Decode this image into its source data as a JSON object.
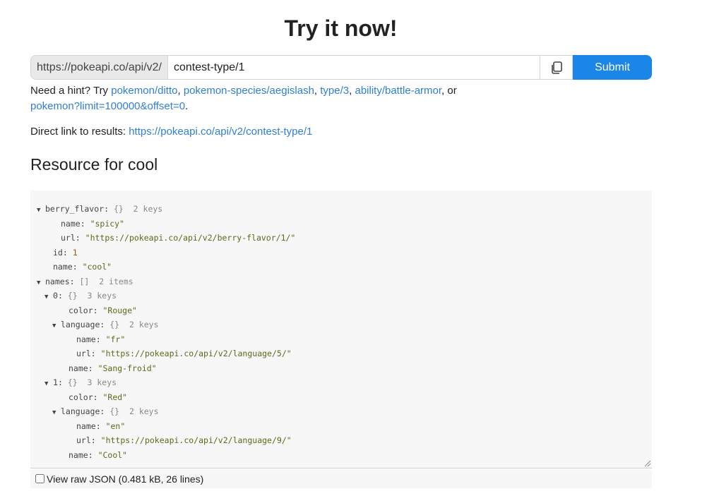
{
  "title": "Try it now!",
  "api": {
    "prefix": "https://pokeapi.co/api/v2/",
    "endpoint": "contest-type/1",
    "submit_label": "Submit",
    "copy_icon": "copy-icon"
  },
  "hint": {
    "lead": "Need a hint? Try",
    "links": [
      "pokemon/ditto",
      "pokemon-species/aegislash",
      "type/3",
      "ability/battle-armor",
      "pokemon?limit=100000&offset=0"
    ],
    "sep_or": ", or",
    "end": "."
  },
  "direct": {
    "label": "Direct link to results:",
    "url": "https://pokeapi.co/api/v2/contest-type/1"
  },
  "resource_heading": "Resource for cool",
  "json_view": {
    "lines": [
      {
        "indent": 0,
        "arrow": true,
        "key": "berry_flavor",
        "brace": "{}",
        "meta": "2 keys"
      },
      {
        "indent": 2,
        "arrow": false,
        "key": "name",
        "str": "\"spicy\""
      },
      {
        "indent": 2,
        "arrow": false,
        "key": "url",
        "str": "\"https://pokeapi.co/api/v2/berry-flavor/1/\""
      },
      {
        "indent": 1,
        "arrow": false,
        "key": "id",
        "num": "1"
      },
      {
        "indent": 1,
        "arrow": false,
        "key": "name",
        "str": "\"cool\""
      },
      {
        "indent": 0,
        "arrow": true,
        "key": "names",
        "brace": "[]",
        "meta": "2 items"
      },
      {
        "indent": 1,
        "arrow": true,
        "key": "0",
        "brace": "{}",
        "meta": "3 keys"
      },
      {
        "indent": 3,
        "arrow": false,
        "key": "color",
        "str": "\"Rouge\""
      },
      {
        "indent": 2,
        "arrow": true,
        "key": "language",
        "brace": "{}",
        "meta": "2 keys"
      },
      {
        "indent": 4,
        "arrow": false,
        "key": "name",
        "str": "\"fr\""
      },
      {
        "indent": 4,
        "arrow": false,
        "key": "url",
        "str": "\"https://pokeapi.co/api/v2/language/5/\""
      },
      {
        "indent": 3,
        "arrow": false,
        "key": "name",
        "str": "\"Sang-froid\""
      },
      {
        "indent": 1,
        "arrow": true,
        "key": "1",
        "brace": "{}",
        "meta": "3 keys"
      },
      {
        "indent": 3,
        "arrow": false,
        "key": "color",
        "str": "\"Red\""
      },
      {
        "indent": 2,
        "arrow": true,
        "key": "language",
        "brace": "{}",
        "meta": "2 keys"
      },
      {
        "indent": 4,
        "arrow": false,
        "key": "name",
        "str": "\"en\""
      },
      {
        "indent": 4,
        "arrow": false,
        "key": "url",
        "str": "\"https://pokeapi.co/api/v2/language/9/\""
      },
      {
        "indent": 3,
        "arrow": false,
        "key": "name",
        "str": "\"Cool\""
      }
    ]
  },
  "raw_toggle": {
    "label": "View raw JSON (0.481 kB, 26 lines)",
    "checked": false
  },
  "colors": {
    "accent": "#1a86e8",
    "link": "#2f7fd6"
  }
}
